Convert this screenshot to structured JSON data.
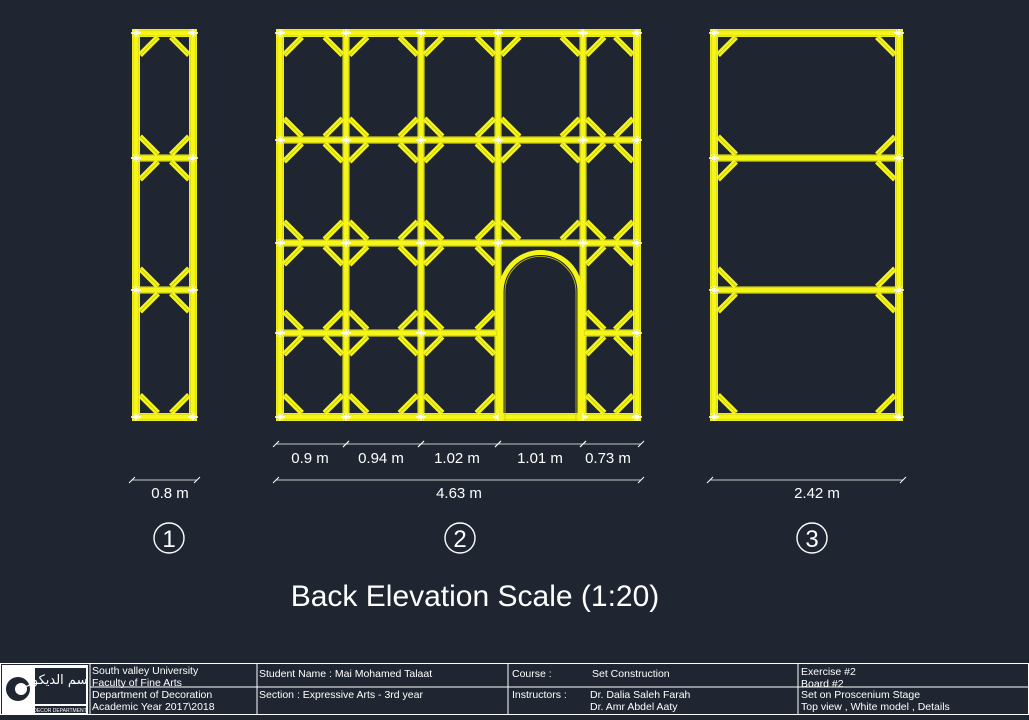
{
  "colors": {
    "background": "#1f2631",
    "frame": "#f5f51a",
    "lines": "#ffffff"
  },
  "panels": [
    {
      "number": "1",
      "total_dim": "0.8 m",
      "sub_dims": []
    },
    {
      "number": "2",
      "total_dim": "4.63 m",
      "sub_dims": [
        "0.9 m",
        "0.94 m",
        "1.02 m",
        "1.01 m",
        "0.73 m"
      ]
    },
    {
      "number": "3",
      "total_dim": "2.42 m",
      "sub_dims": []
    }
  ],
  "title": "Back Elevation Scale (1:20)",
  "title_block": {
    "university": "South valley University",
    "faculty": "Faculty of Fine Arts",
    "department": "Department of Decoration",
    "academic_year": "Academic Year 2017\\2018",
    "student": "Student Name : Mai Mohamed Talaat",
    "section": "Section : Expressive Arts - 3rd year",
    "course_label": "Course :",
    "course_value": "Set Construction",
    "instructors_label": "Instructors :",
    "instructor_1": "Dr. Dalia Saleh Farah",
    "instructor_2": "Dr. Amr Abdel Aaty",
    "exercise": "Exercise #2",
    "board": "Board #2",
    "set_on": "Set on Proscenium Stage",
    "views": "Top view , White model  , Details"
  },
  "logo": {
    "text_ar": "قسم الديكور",
    "caption": "DECOR DEPARTMENT",
    "icon": "decor-department-logo-icon"
  }
}
